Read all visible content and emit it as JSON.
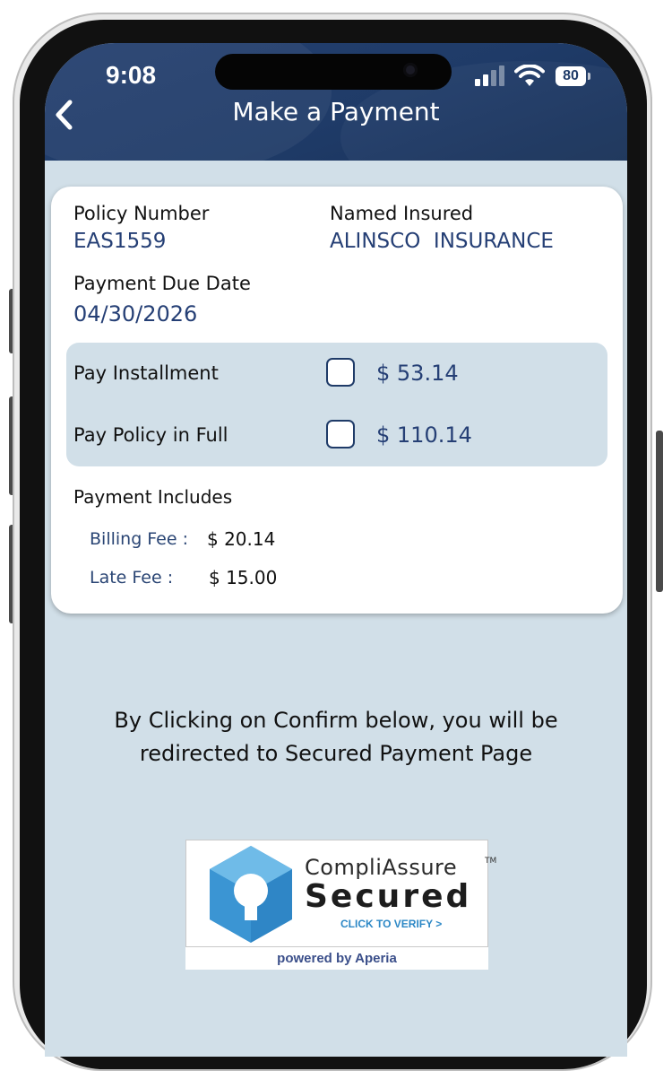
{
  "status_bar": {
    "time": "9:08",
    "battery": "80"
  },
  "header": {
    "title": "Make a Payment",
    "back_icon": "chevron-left-icon"
  },
  "policy": {
    "number_label": "Policy Number",
    "number_value": "EAS1559",
    "insured_label": "Named Insured",
    "insured_value": "ALINSCO  INSURANCE",
    "due_label": "Payment Due Date",
    "due_value": "04/30/2026"
  },
  "options": [
    {
      "label": "Pay Installment",
      "amount": "$ 53.14",
      "checked": false
    },
    {
      "label": "Pay Policy in Full",
      "amount": "$ 110.14",
      "checked": false
    }
  ],
  "includes": {
    "title": "Payment Includes",
    "fees": [
      {
        "label": "Billing Fee :",
        "value": "$ 20.14"
      },
      {
        "label": "Late Fee :",
        "value": "$ 15.00"
      }
    ]
  },
  "notice": {
    "line1": "By Clicking on Confirm below, you will be",
    "line2": "redirected to Secured Payment Page"
  },
  "seal": {
    "brand": "CompliAssure",
    "trademark": "TM",
    "secured": "Secured",
    "verify": "CLICK TO VERIFY >",
    "powered_by": "powered by Aperia"
  },
  "colors": {
    "header": "#1f3b68",
    "screen_bg": "#d1dfe8",
    "accent_text": "#253f75",
    "verify_blue": "#2d88c6"
  }
}
